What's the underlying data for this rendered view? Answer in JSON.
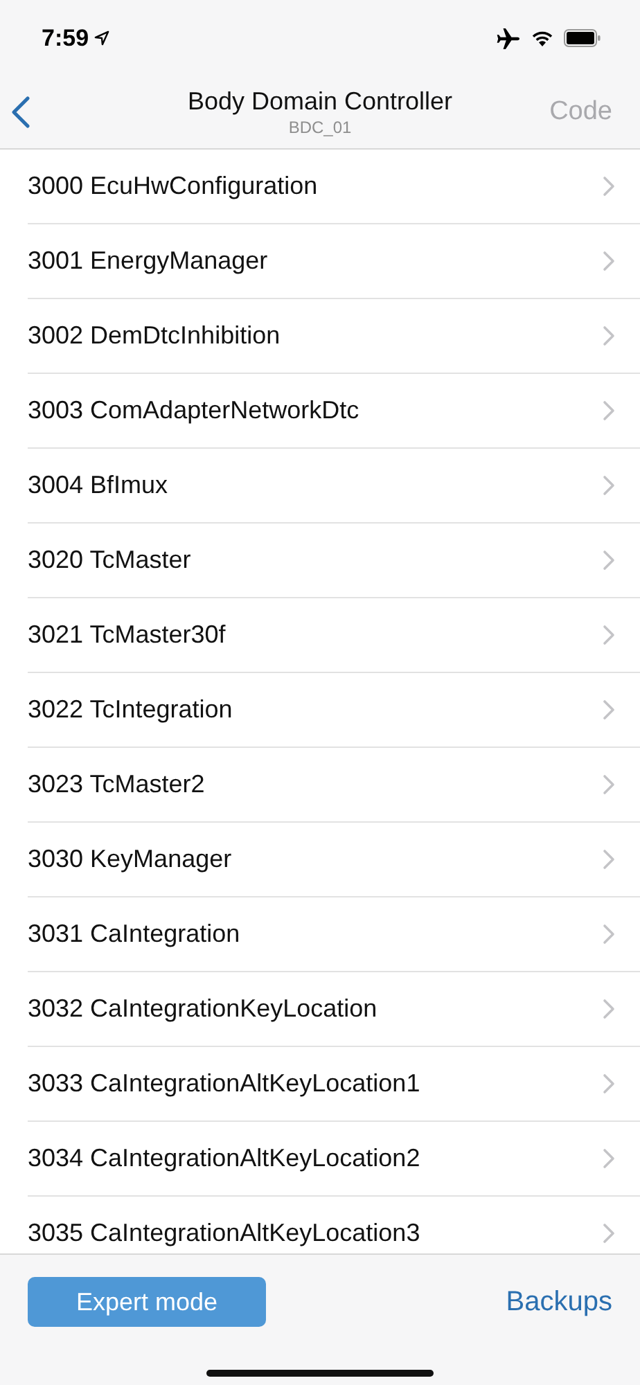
{
  "status_bar": {
    "time": "7:59"
  },
  "nav": {
    "title": "Body Domain Controller",
    "subtitle": "BDC_01",
    "action": {
      "label": "Code",
      "disabled": true
    }
  },
  "items": [
    {
      "label": "3000 EcuHwConfiguration"
    },
    {
      "label": "3001 EnergyManager"
    },
    {
      "label": "3002 DemDtcInhibition"
    },
    {
      "label": "3003 ComAdapterNetworkDtc"
    },
    {
      "label": "3004 BfImux"
    },
    {
      "label": "3020 TcMaster"
    },
    {
      "label": "3021 TcMaster30f"
    },
    {
      "label": "3022 TcIntegration"
    },
    {
      "label": "3023 TcMaster2"
    },
    {
      "label": "3030 KeyManager"
    },
    {
      "label": "3031 CaIntegration"
    },
    {
      "label": "3032 CaIntegrationKeyLocation"
    },
    {
      "label": "3033 CaIntegrationAltKeyLocation1"
    },
    {
      "label": "3034 CaIntegrationAltKeyLocation2"
    },
    {
      "label": "3035 CaIntegrationAltKeyLocation3"
    }
  ],
  "toolbar": {
    "primary": "Expert mode",
    "secondary": "Backups"
  }
}
